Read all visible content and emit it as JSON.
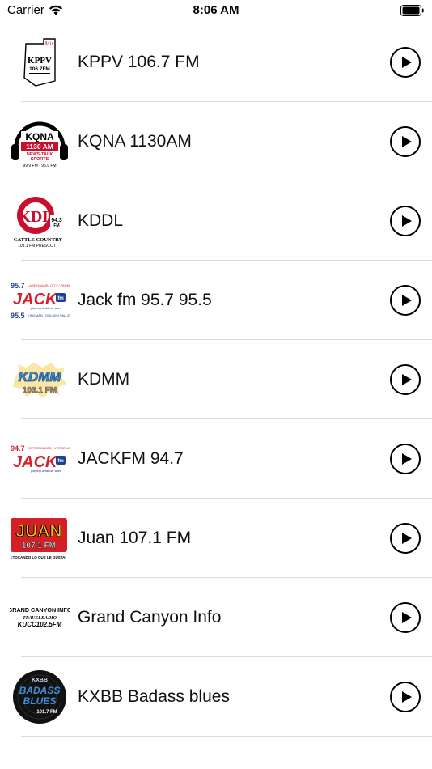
{
  "status_bar": {
    "carrier": "Carrier",
    "time": "8:06 AM"
  },
  "stations": [
    {
      "name": "KPPV 106.7 FM",
      "logo_icon": "kppv-logo",
      "logo_text": "KPPV",
      "logo_sub": "106.7 FM"
    },
    {
      "name": "KQNA 1130AM",
      "logo_icon": "kqna-logo",
      "logo_text": "KQNA",
      "logo_sub": "1130 AM"
    },
    {
      "name": "KDDL",
      "logo_icon": "kddl-logo",
      "logo_text": "KDDL",
      "logo_sub": "CATTLE COUNTRY"
    },
    {
      "name": "Jack fm 95.7 95.5",
      "logo_icon": "jack-logo",
      "logo_text": "JACK",
      "logo_sub": "95.7 / 95.5"
    },
    {
      "name": "KDMM",
      "logo_icon": "kdmm-logo",
      "logo_text": "KDMM",
      "logo_sub": "103.1 FM"
    },
    {
      "name": "JACKFM 94.7",
      "logo_icon": "jack-947-logo",
      "logo_text": "JACK",
      "logo_sub": "94.7"
    },
    {
      "name": "Juan 107.1 FM",
      "logo_icon": "juan-logo",
      "logo_text": "JUAN",
      "logo_sub": "107.1 FM"
    },
    {
      "name": "Grand Canyon Info",
      "logo_icon": "grand-canyon-logo",
      "logo_text": "GRAND CANYON INFO",
      "logo_sub": "KUCC 102.5FM"
    },
    {
      "name": "KXBB Badass blues",
      "logo_icon": "kxbb-logo",
      "logo_text": "BADASS BLUES",
      "logo_sub": "101.7 FM"
    }
  ],
  "colors": {
    "separator": "#dcdcdc",
    "kqna_red": "#c8102e",
    "jack_blue": "#1f3f9a",
    "jack_red": "#d8202a",
    "juan_red": "#d32027",
    "juan_yellow": "#f4c20d",
    "kdmm_blue": "#3d8fd6",
    "kdmm_orange": "#f39a1e"
  }
}
